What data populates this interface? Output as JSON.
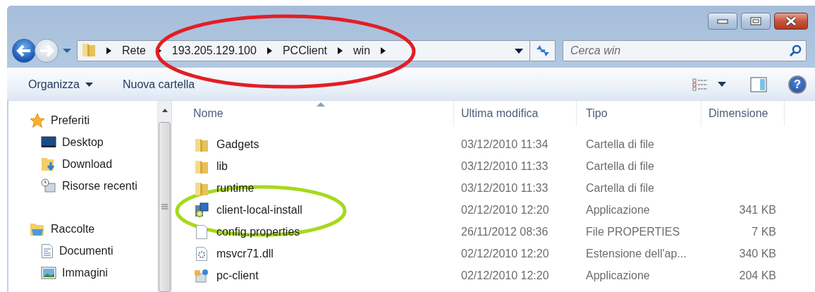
{
  "navigation": {
    "breadcrumbs": [
      "Rete",
      "193.205.129.100",
      "PCClient",
      "win"
    ],
    "search": {
      "placeholder": "Cerca win"
    }
  },
  "toolbar": {
    "buttons": [
      {
        "label": "Organizza",
        "dropdown": true
      },
      {
        "label": "Nuova cartella",
        "dropdown": false
      }
    ],
    "help": "?"
  },
  "sidebar": {
    "groups": [
      {
        "label": "Preferiti",
        "kind": "favorites",
        "children": [
          {
            "label": "Desktop",
            "kind": "desktop"
          },
          {
            "label": "Download",
            "kind": "download"
          },
          {
            "label": "Risorse recenti",
            "kind": "recent"
          }
        ]
      },
      {
        "label": "Raccolte",
        "kind": "libraries",
        "children": [
          {
            "label": "Documenti",
            "kind": "documents"
          },
          {
            "label": "Immagini",
            "kind": "pictures"
          }
        ]
      }
    ]
  },
  "table": {
    "columns": [
      {
        "label": "Nome",
        "sorted": true
      },
      {
        "label": "Ultima modifica",
        "sorted": false
      },
      {
        "label": "Tipo",
        "sorted": false
      },
      {
        "label": "Dimensione",
        "sorted": false
      }
    ],
    "rows": [
      {
        "kind": "folder",
        "name": "Gadgets",
        "modified": "03/12/2010 11:34",
        "type": "Cartella di file"
      },
      {
        "kind": "folder",
        "name": "lib",
        "modified": "03/12/2010 11:33",
        "type": "Cartella di file"
      },
      {
        "kind": "folder",
        "name": "runtime",
        "modified": "03/12/2010 11:33",
        "type": "Cartella di file"
      },
      {
        "kind": "installer",
        "name": "client-local-install",
        "modified": "02/12/2010 12:20",
        "type": "Applicazione",
        "size": "341 KB"
      },
      {
        "kind": "file",
        "name": "config.properties",
        "modified": "26/11/2012 08:36",
        "type": "File PROPERTIES",
        "size": "7 KB"
      },
      {
        "kind": "dll",
        "name": "msvcr71.dll",
        "modified": "02/12/2010 12:20",
        "type": "Estensione dell'ap...",
        "size": "340 KB"
      },
      {
        "kind": "app",
        "name": "pc-client",
        "modified": "02/12/2010 12:20",
        "type": "Applicazione",
        "size": "204 KB"
      }
    ]
  },
  "annotations": [
    {
      "kind": "address",
      "color": "#e31e26"
    },
    {
      "kind": "row",
      "color": "#a6d91c"
    }
  ]
}
